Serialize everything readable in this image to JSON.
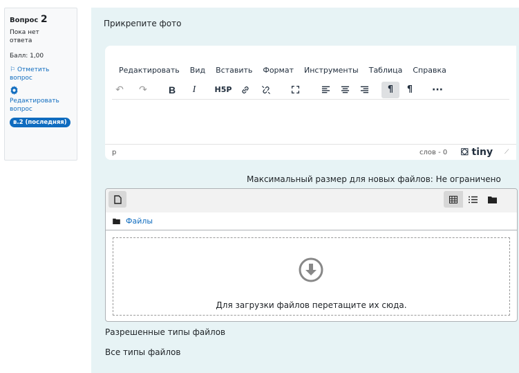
{
  "info": {
    "question_label": "Вопрос",
    "question_number": "2",
    "state_line1": "Пока нет",
    "state_line2": "ответа",
    "grade": "Балл: 1,00",
    "flag_line1": "Отметить",
    "flag_line2": "вопрос",
    "edit_line1": "Редактировать",
    "edit_line2": "вопрос",
    "version_badge": "в.2 (последняя)"
  },
  "prompt": "Прикрепите фото",
  "editor": {
    "menu": [
      "Редактировать",
      "Вид",
      "Вставить",
      "Формат",
      "Инструменты",
      "Таблица",
      "Справка"
    ],
    "path": "p",
    "word_count": "слов - 0",
    "brand": "tiny"
  },
  "filemanager": {
    "max_size": "Максимальный размер для новых файлов: Не ограничено",
    "folder": "Файлы",
    "drop_text": "Для загрузки файлов перетащите их сюда."
  },
  "allowed_types_label": "Разрешенные типы файлов",
  "allowed_types_value": "Все типы файлов",
  "colors": {
    "accent": "#0f6cbf",
    "panel": "#e7f3f5"
  }
}
